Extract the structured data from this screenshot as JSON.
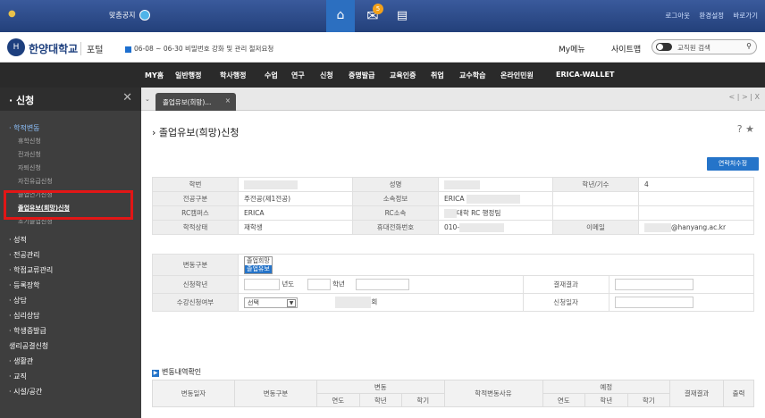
{
  "topbar": {
    "notice": "맞춤공지",
    "home_icon": "home-icon",
    "mail_badge": "5",
    "right_links": [
      "로그아웃",
      "환경설정",
      "바로가기"
    ]
  },
  "header": {
    "logo_text": "한양대학교",
    "portal": "포털",
    "notice": "06-08 ~ 06-30 비밀번호 강화 및 관리 철저요청",
    "my_menu": "My메뉴",
    "sitemap": "사이트맵",
    "search_label": "교직원 검색"
  },
  "menubar": [
    "MY홈",
    "일반행정",
    "학사행정",
    "수업",
    "연구",
    "신청",
    "증명발급",
    "교육인증",
    "취업",
    "교수학습",
    "온라인민원",
    "ERICA-WALLET"
  ],
  "sidebar": {
    "title": "신청",
    "active_category": "학적변동",
    "sub_items": [
      "휴학신청",
      "전과신청",
      "자퇴신청",
      "자진유급신청",
      "졸업연기신청",
      "졸업유보(희망)신청",
      "조기졸업신청"
    ],
    "categories": [
      "성적",
      "전공관리",
      "학점교류관리",
      "등록장학",
      "상담",
      "심리상담",
      "학생증발급",
      "생리공결신청",
      "생활관",
      "교직",
      "시설/공간"
    ]
  },
  "tab": {
    "label": "졸업유보(희망)...",
    "nav": "< | > | X"
  },
  "page": {
    "title": "졸업유보(희망)신청",
    "tools": "? ★",
    "contact_btn": "연락처수정"
  },
  "info": {
    "row1": [
      "학번",
      "성명",
      "학년/기수",
      "4"
    ],
    "row2": [
      "전공구분",
      "주전공(제1전공)",
      "소속정보",
      "ERICA"
    ],
    "row3": [
      "RC캠퍼스",
      "ERICA",
      "RC소속",
      "대학 RC 행정팀"
    ],
    "row4": [
      "학적상태",
      "재학생",
      "휴대전화번호",
      "010-",
      "이메일",
      "@hanyang.ac.kr"
    ]
  },
  "form": {
    "change_type_label": "변동구분",
    "options": [
      "졸업희망",
      "졸업유보"
    ],
    "apply_term_label": "신청학년",
    "year_label": "년도",
    "grade_label": "학년",
    "result_label": "결재결과",
    "course_label": "수강신청여부",
    "select_text": "선택",
    "times_label": "회",
    "apply_date_label": "신청일자"
  },
  "history": {
    "title": "변동내역확인",
    "col_date": "변동일자",
    "col_type": "변동구분",
    "grp_change": "변동",
    "col_reason": "학적변동사유",
    "grp_plan": "예정",
    "col_result": "결재결과",
    "col_print": "출력",
    "sub": [
      "연도",
      "학년",
      "학기",
      "연도",
      "학년",
      "학기"
    ]
  }
}
